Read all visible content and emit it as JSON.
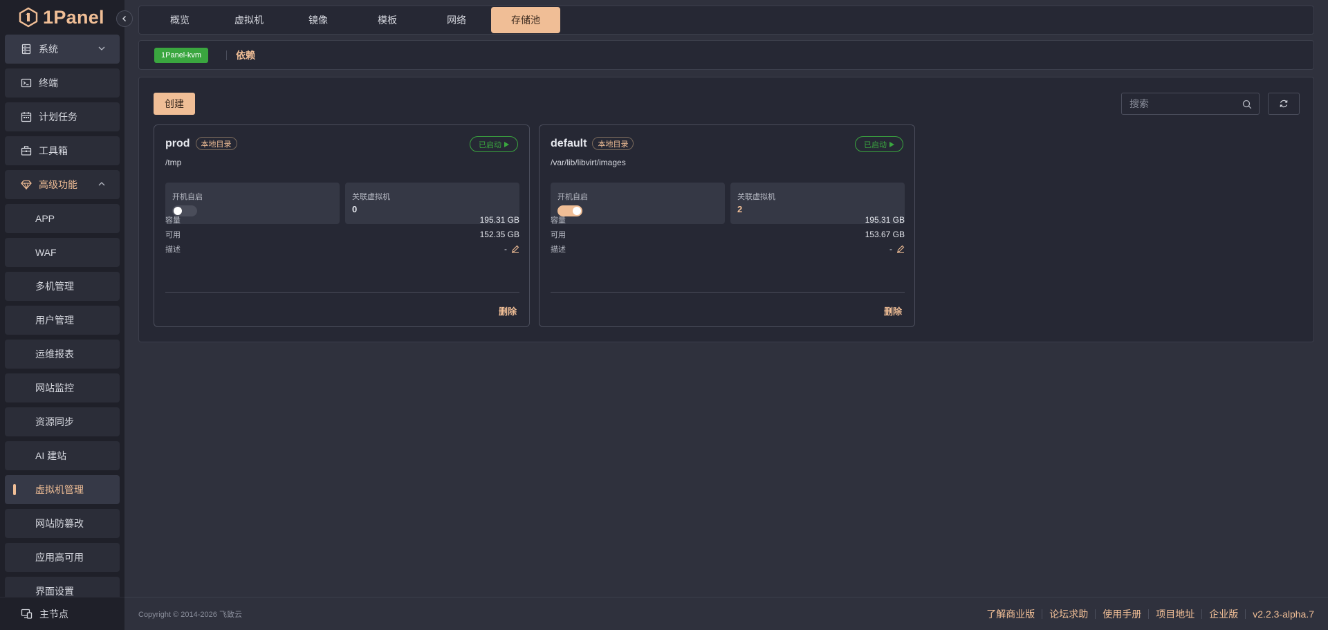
{
  "app": {
    "logo_text": "1Panel"
  },
  "colors": {
    "accent": "#f0be96",
    "success": "#3aa63f",
    "sidebar_bg": "#1f2029",
    "page_bg": "#2f313d"
  },
  "sidebar": {
    "system": {
      "label": "系统",
      "icon": "server-icon"
    },
    "items": [
      {
        "label": "终端",
        "icon": "terminal-icon"
      },
      {
        "label": "计划任务",
        "icon": "calendar-icon"
      },
      {
        "label": "工具箱",
        "icon": "toolbox-icon"
      }
    ],
    "advanced": {
      "label": "高级功能",
      "icon": "diamond-icon"
    },
    "sub_items": [
      {
        "label": "APP"
      },
      {
        "label": "WAF"
      },
      {
        "label": "多机管理"
      },
      {
        "label": "用户管理"
      },
      {
        "label": "运维报表"
      },
      {
        "label": "网站监控"
      },
      {
        "label": "资源同步"
      },
      {
        "label": "AI 建站"
      },
      {
        "label": "虚拟机管理"
      },
      {
        "label": "网站防篡改"
      },
      {
        "label": "应用高可用"
      },
      {
        "label": "界面设置"
      }
    ],
    "footer": {
      "label": "主节点",
      "icon": "node-icon"
    }
  },
  "tabs": [
    "概览",
    "虚拟机",
    "镜像",
    "模板",
    "网络",
    "存储池"
  ],
  "subbar": {
    "tag": "1Panel-kvm",
    "link": "依赖"
  },
  "toolbar": {
    "create_label": "创建",
    "search_placeholder": "搜索"
  },
  "pools": [
    {
      "name": "prod",
      "type": "本地目录",
      "status": "已启动",
      "path": "/tmp",
      "autostart_label": "开机自启",
      "autostart": false,
      "vms_label": "关联虚拟机",
      "vms": "0",
      "capacity_label": "容量",
      "capacity": "195.31 GB",
      "available_label": "可用",
      "available": "152.35 GB",
      "desc_label": "描述",
      "desc": "-",
      "delete_label": "删除"
    },
    {
      "name": "default",
      "type": "本地目录",
      "status": "已启动",
      "path": "/var/lib/libvirt/images",
      "autostart_label": "开机自启",
      "autostart": true,
      "vms_label": "关联虚拟机",
      "vms": "2",
      "capacity_label": "容量",
      "capacity": "195.31 GB",
      "available_label": "可用",
      "available": "153.67 GB",
      "desc_label": "描述",
      "desc": "-",
      "delete_label": "删除"
    }
  ],
  "footer": {
    "copyright": "Copyright © 2014-2026 飞致云",
    "links": [
      "了解商业版",
      "论坛求助",
      "使用手册",
      "项目地址"
    ],
    "edition": "企业版",
    "version": "v2.2.3-alpha.7"
  }
}
